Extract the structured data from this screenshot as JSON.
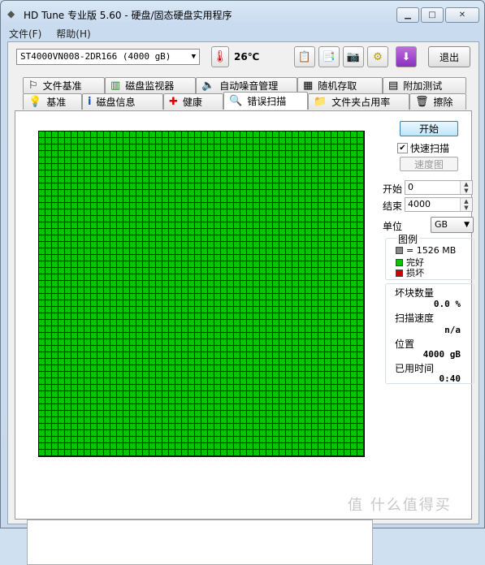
{
  "window": {
    "title": "HD Tune 专业版 5.60 - 硬盘/固态硬盘实用程序",
    "minimize": "▁",
    "maximize": "□",
    "close": "✕"
  },
  "menu": [
    "文件(F)",
    "帮助(H)"
  ],
  "toolbar": {
    "drive": "ST4000VN008-2DR166 (4000 gB)",
    "temperature": "26℃",
    "exit_label": "退出"
  },
  "tabs_row1": [
    {
      "label": "文件基准",
      "icon": "file-benchmark-icon"
    },
    {
      "label": "磁盘监视器",
      "icon": "disk-monitor-icon"
    },
    {
      "label": "自动噪音管理",
      "icon": "speaker-icon"
    },
    {
      "label": "随机存取",
      "icon": "random-access-icon"
    },
    {
      "label": "附加测试",
      "icon": "extra-tests-icon"
    }
  ],
  "tabs_row2": [
    {
      "label": "基准",
      "icon": "benchmark-icon"
    },
    {
      "label": "磁盘信息",
      "icon": "info-icon"
    },
    {
      "label": "健康",
      "icon": "health-cross-icon"
    },
    {
      "label": "错误扫描",
      "icon": "magnifier-icon",
      "active": true
    },
    {
      "label": "文件夹占用率",
      "icon": "folder-icon"
    },
    {
      "label": "擦除",
      "icon": "trash-icon"
    }
  ],
  "scan": {
    "start_label": "开始",
    "quick_scan_label": "快速扫描",
    "quick_scan_checked": true,
    "speed_map_label": "速度图",
    "start_field_label": "开始",
    "start_value": "0",
    "end_field_label": "结束",
    "end_value": "4000",
    "unit_label": "单位",
    "unit_value": "GB",
    "legend_title": "图例",
    "legend_block": "= 1526 MB",
    "legend_ok": "完好",
    "legend_bad": "损坏",
    "block_color": "#00c800",
    "bad_color": "#cc0000",
    "bad_blocks_label": "坏块数量",
    "bad_blocks_value": "0.0 %",
    "scan_speed_label": "扫描速度",
    "scan_speed_value": "n/a",
    "position_label": "位置",
    "position_value": "4000 gB",
    "elapsed_label": "已用时间",
    "elapsed_value": "0:40"
  },
  "watermark": "值 什么值得买"
}
